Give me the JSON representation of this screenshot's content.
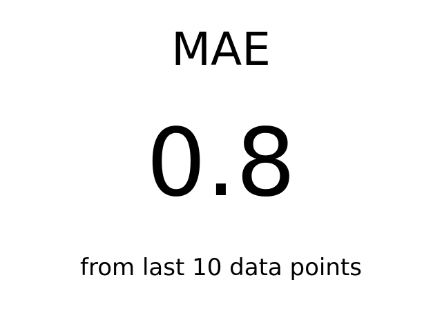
{
  "metric": {
    "title": "MAE",
    "value": "0.8",
    "caption": "from last 10 data points"
  },
  "colors": {
    "background": "#ffffff",
    "text": "#000000"
  }
}
